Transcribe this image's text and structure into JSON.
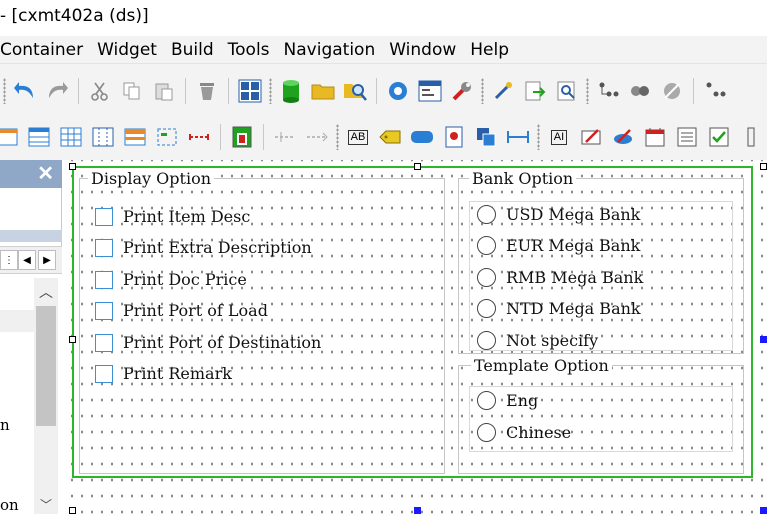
{
  "window": {
    "title": "- [cxmt402a (ds)]"
  },
  "menu": [
    "Container",
    "Widget",
    "Build",
    "Tools",
    "Navigation",
    "Window",
    "Help"
  ],
  "toolbar_top": [
    "back-arrow-icon",
    "forward-arrow-icon",
    "cut-icon",
    "copy-icon",
    "paste-icon",
    "delete-icon",
    "grid-icon",
    "database-icon",
    "folder-icon",
    "explore-icon",
    "gear-icon",
    "form-icon",
    "wrench-icon",
    "wand-icon",
    "export-icon",
    "preview-icon",
    "tree-icon",
    "link-icon",
    "tool-icon",
    "more-icon"
  ],
  "toolbar_widgets": {
    "text_ab": "AB",
    "text_ai": "AI"
  },
  "left_panel": {
    "close": "✕",
    "text1": "n",
    "text2": "on"
  },
  "display_option": {
    "title": "Display Option",
    "items": [
      "Print Item Desc",
      "Print Extra Description",
      "Print Doc Price",
      "Print Port of Load",
      "Print Port of Destination",
      "Print Remark"
    ]
  },
  "bank_option": {
    "title": "Bank Option",
    "items": [
      "USD Mega Bank",
      "EUR Mega Bank",
      "RMB Mega Bank",
      "NTD Mega Bank",
      "Not specify"
    ]
  },
  "template_option": {
    "title": "Template Option",
    "items": [
      "Eng",
      "Chinese"
    ]
  },
  "colors": {
    "selection_frame": "#2db52d",
    "checkbox_border": "#3a8fd6",
    "panel_header": "#8fa8c8"
  }
}
